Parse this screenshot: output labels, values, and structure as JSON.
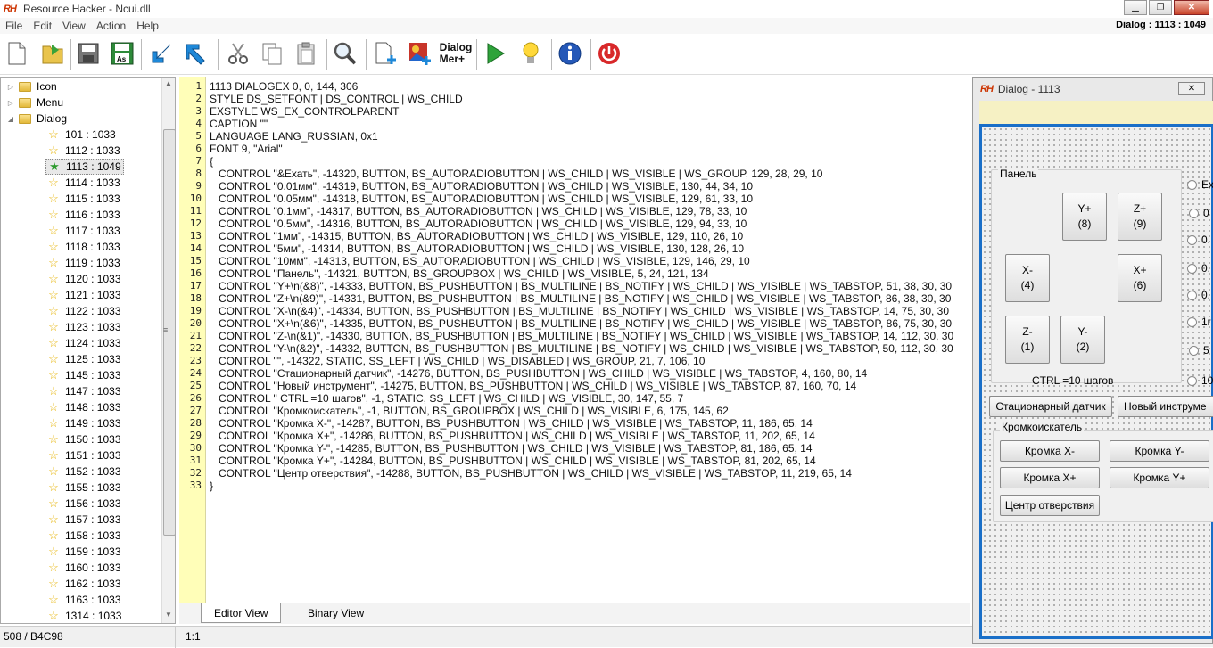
{
  "window": {
    "title": "Resource Hacker - Ncui.dll",
    "logo": "RH"
  },
  "menu": [
    "File",
    "Edit",
    "View",
    "Action",
    "Help"
  ],
  "dialog_label": "Dialog : 1113 : 1049",
  "toolbar": {
    "dialog_menu_label": "Dialog\nMer+"
  },
  "tree": {
    "folders": [
      {
        "label": "Icon",
        "expander": "▷"
      },
      {
        "label": "Menu",
        "expander": "▷"
      },
      {
        "label": "Dialog",
        "expander": "◢"
      }
    ],
    "items": [
      "101 : 1033",
      "1112 : 1033",
      "1113 : 1049",
      "1114 : 1033",
      "1115 : 1033",
      "1116 : 1033",
      "1117 : 1033",
      "1118 : 1033",
      "1119 : 1033",
      "1120 : 1033",
      "1121 : 1033",
      "1122 : 1033",
      "1123 : 1033",
      "1124 : 1033",
      "1125 : 1033",
      "1145 : 1033",
      "1147 : 1033",
      "1148 : 1033",
      "1149 : 1033",
      "1150 : 1033",
      "1151 : 1033",
      "1152 : 1033",
      "1155 : 1033",
      "1156 : 1033",
      "1157 : 1033",
      "1158 : 1033",
      "1159 : 1033",
      "1160 : 1033",
      "1162 : 1033",
      "1163 : 1033",
      "1314 : 1033"
    ],
    "selected": "1113 : 1049"
  },
  "editor": {
    "lines": [
      "1113 DIALOGEX 0, 0, 144, 306",
      "STYLE DS_SETFONT | DS_CONTROL | WS_CHILD",
      "EXSTYLE WS_EX_CONTROLPARENT",
      "CAPTION \"\"",
      "LANGUAGE LANG_RUSSIAN, 0x1",
      "FONT 9, \"Arial\"",
      "{",
      "   CONTROL \"&Ехать\", -14320, BUTTON, BS_AUTORADIOBUTTON | WS_CHILD | WS_VISIBLE | WS_GROUP, 129, 28, 29, 10",
      "   CONTROL \"0.01мм\", -14319, BUTTON, BS_AUTORADIOBUTTON | WS_CHILD | WS_VISIBLE, 130, 44, 34, 10",
      "   CONTROL \"0.05мм\", -14318, BUTTON, BS_AUTORADIOBUTTON | WS_CHILD | WS_VISIBLE, 129, 61, 33, 10",
      "   CONTROL \"0.1мм\", -14317, BUTTON, BS_AUTORADIOBUTTON | WS_CHILD | WS_VISIBLE, 129, 78, 33, 10",
      "   CONTROL \"0.5мм\", -14316, BUTTON, BS_AUTORADIOBUTTON | WS_CHILD | WS_VISIBLE, 129, 94, 33, 10",
      "   CONTROL \"1мм\", -14315, BUTTON, BS_AUTORADIOBUTTON | WS_CHILD | WS_VISIBLE, 129, 110, 26, 10",
      "   CONTROL \"5мм\", -14314, BUTTON, BS_AUTORADIOBUTTON | WS_CHILD | WS_VISIBLE, 130, 128, 26, 10",
      "   CONTROL \"10мм\", -14313, BUTTON, BS_AUTORADIOBUTTON | WS_CHILD | WS_VISIBLE, 129, 146, 29, 10",
      "   CONTROL \"Панель\", -14321, BUTTON, BS_GROUPBOX | WS_CHILD | WS_VISIBLE, 5, 24, 121, 134",
      "   CONTROL \"Y+\\n(&8)\", -14333, BUTTON, BS_PUSHBUTTON | BS_MULTILINE | BS_NOTIFY | WS_CHILD | WS_VISIBLE | WS_TABSTOP, 51, 38, 30, 30",
      "   CONTROL \"Z+\\n(&9)\", -14331, BUTTON, BS_PUSHBUTTON | BS_MULTILINE | BS_NOTIFY | WS_CHILD | WS_VISIBLE | WS_TABSTOP, 86, 38, 30, 30",
      "   CONTROL \"X-\\n(&4)\", -14334, BUTTON, BS_PUSHBUTTON | BS_MULTILINE | BS_NOTIFY | WS_CHILD | WS_VISIBLE | WS_TABSTOP, 14, 75, 30, 30",
      "   CONTROL \"X+\\n(&6)\", -14335, BUTTON, BS_PUSHBUTTON | BS_MULTILINE | BS_NOTIFY | WS_CHILD | WS_VISIBLE | WS_TABSTOP, 86, 75, 30, 30",
      "   CONTROL \"Z-\\n(&1)\", -14330, BUTTON, BS_PUSHBUTTON | BS_MULTILINE | BS_NOTIFY | WS_CHILD | WS_VISIBLE | WS_TABSTOP, 14, 112, 30, 30",
      "   CONTROL \"Y-\\n(&2)\", -14332, BUTTON, BS_PUSHBUTTON | BS_MULTILINE | BS_NOTIFY | WS_CHILD | WS_VISIBLE | WS_TABSTOP, 50, 112, 30, 30",
      "   CONTROL \"\", -14322, STATIC, SS_LEFT | WS_CHILD | WS_DISABLED | WS_GROUP, 21, 7, 106, 10",
      "   CONTROL \"Стационарный датчик\", -14276, BUTTON, BS_PUSHBUTTON | WS_CHILD | WS_VISIBLE | WS_TABSTOP, 4, 160, 80, 14",
      "   CONTROL \"Новый инструмент\", -14275, BUTTON, BS_PUSHBUTTON | WS_CHILD | WS_VISIBLE | WS_TABSTOP, 87, 160, 70, 14",
      "   CONTROL \" CTRL =10 шагов\", -1, STATIC, SS_LEFT | WS_CHILD | WS_VISIBLE, 30, 147, 55, 7",
      "   CONTROL \"Кромкоискатель\", -1, BUTTON, BS_GROUPBOX | WS_CHILD | WS_VISIBLE, 6, 175, 145, 62",
      "   CONTROL \"Кромка X-\", -14287, BUTTON, BS_PUSHBUTTON | WS_CHILD | WS_VISIBLE | WS_TABSTOP, 11, 186, 65, 14",
      "   CONTROL \"Кромка X+\", -14286, BUTTON, BS_PUSHBUTTON | WS_CHILD | WS_VISIBLE | WS_TABSTOP, 11, 202, 65, 14",
      "   CONTROL \"Кромка Y-\", -14285, BUTTON, BS_PUSHBUTTON | WS_CHILD | WS_VISIBLE | WS_TABSTOP, 81, 186, 65, 14",
      "   CONTROL \"Кромка Y+\", -14284, BUTTON, BS_PUSHBUTTON | WS_CHILD | WS_VISIBLE | WS_TABSTOP, 81, 202, 65, 14",
      "   CONTROL \"Центр отверствия\", -14288, BUTTON, BS_PUSHBUTTON | WS_CHILD | WS_VISIBLE | WS_TABSTOP, 11, 219, 65, 14",
      "}"
    ]
  },
  "tabs": {
    "editor": "Editor View",
    "binary": "Binary View"
  },
  "status": {
    "left": "508 / B4C98",
    "cursor": "1:1"
  },
  "preview": {
    "title": "Dialog - 1113",
    "panel_label": "Панель",
    "buttons": {
      "yplus": "Y+\n(8)",
      "zplus": "Z+\n(9)",
      "xminus": "X-\n(4)",
      "xplus": "X+\n(6)",
      "zminus": "Z-\n(1)",
      "yminus": "Y-\n(2)"
    },
    "ctrl_label": "CTRL =10 шагов",
    "radios": [
      "Ex",
      "0",
      "0.",
      "0.",
      "0.",
      "1r",
      "5",
      "10"
    ],
    "station_btn": "Стационарный датчик",
    "new_tool_btn": "Новый инструме",
    "edge_group": "Кромкоискатель",
    "edge_buttons": {
      "xminus": "Кромка X-",
      "yminus": "Кромка Y-",
      "xplus": "Кромка X+",
      "yplus": "Кромка Y+"
    },
    "center_btn": "Центр отверствия"
  },
  "colors": {
    "gutter": "#fffeb8",
    "frame": "#1a6fc8",
    "accent_arrow": "#1e88d8"
  }
}
